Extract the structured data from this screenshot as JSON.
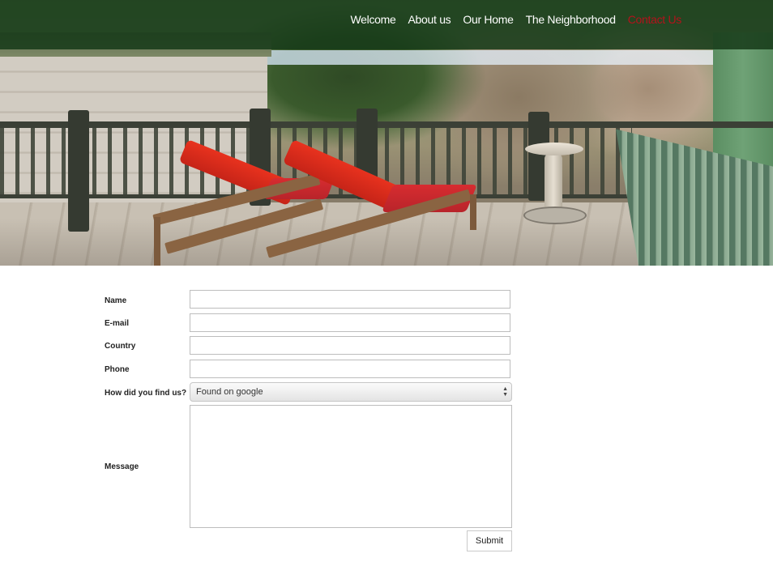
{
  "nav": {
    "items": [
      {
        "label": "Welcome",
        "active": false
      },
      {
        "label": "About us",
        "active": false
      },
      {
        "label": "Our Home",
        "active": false
      },
      {
        "label": "The Neighborhood",
        "active": false
      },
      {
        "label": "Contact Us",
        "active": true
      }
    ]
  },
  "hero": {
    "image_description_icon": "porch-photo"
  },
  "form": {
    "name_label": "Name",
    "email_label": "E-mail",
    "country_label": "Country",
    "phone_label": "Phone",
    "source_label": "How did you find us?",
    "source_selected": "Found on google",
    "message_label": "Message",
    "submit_label": "Submit",
    "name_value": "",
    "email_value": "",
    "country_value": "",
    "phone_value": "",
    "message_value": ""
  },
  "colors": {
    "nav_bg": "#163a18",
    "nav_text": "#ffffff",
    "nav_active": "#b4121b"
  }
}
